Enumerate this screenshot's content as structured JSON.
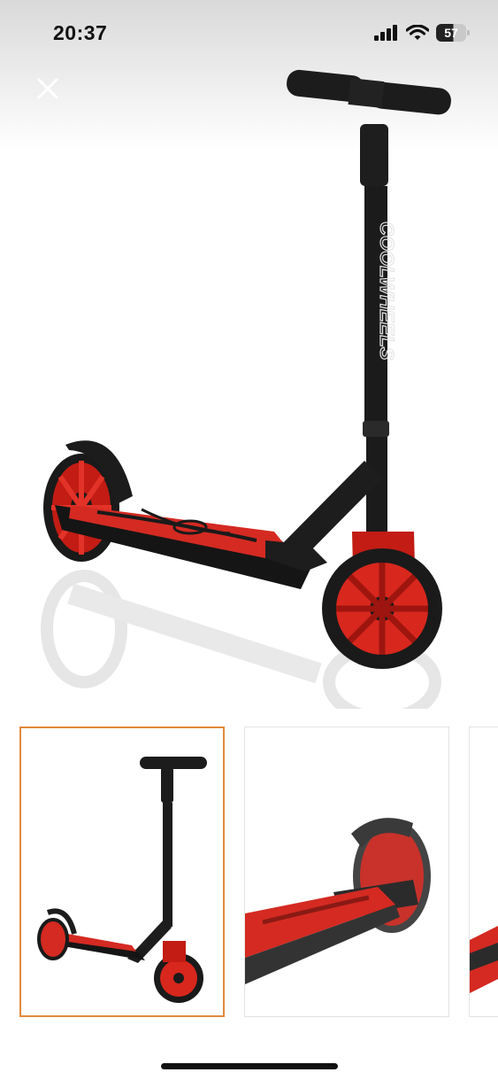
{
  "status_bar": {
    "time": "20:37",
    "battery_level": "57",
    "icons": [
      "cellular-signal-icon",
      "wifi-icon",
      "battery-icon"
    ]
  },
  "viewer": {
    "close_icon": "close-icon",
    "main_image": {
      "logo_text": "COOLWHEELS",
      "colors": {
        "frame": "#1a1a1a",
        "accent": "#e0261b",
        "deck": "#d42a22"
      }
    },
    "thumbnails": [
      {
        "selected": true
      },
      {
        "selected": false
      },
      {
        "selected": false
      }
    ],
    "selected_border_color": "#e08a3c"
  }
}
